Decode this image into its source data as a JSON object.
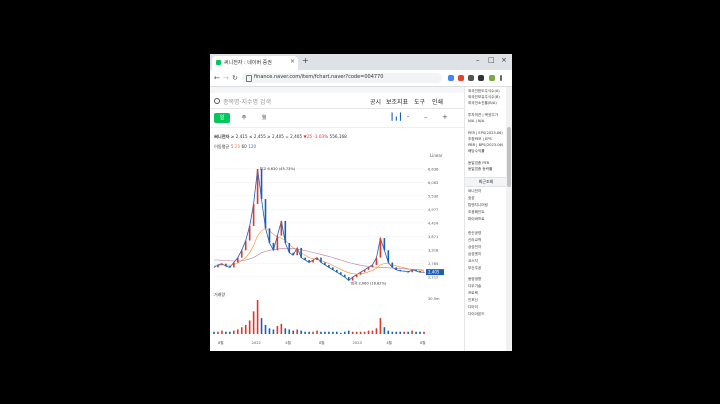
{
  "browser": {
    "tab_title": "써니전자 : 네이버 증권",
    "tab_close": "×",
    "new_tab": "+",
    "url": "finance.naver.com/item/fchart.naver?code=004770",
    "window_controls": {
      "minimize": "–",
      "maximize": "□",
      "close": "×"
    },
    "nav": {
      "back": "←",
      "forward": "→",
      "reload": "↻"
    }
  },
  "search": {
    "placeholder": "종목명·지수명 검색"
  },
  "top_nav": [
    "공시",
    "보조지표",
    "도구",
    "인쇄"
  ],
  "periods": [
    "일",
    "주",
    "월"
  ],
  "active_period": "일",
  "toolbar_icons": [
    "candle-icon",
    "minus-icon",
    "plus-icon"
  ],
  "price_bar": {
    "name": "써니전자",
    "items": [
      "≥ 2,415",
      "≤ 2,455",
      "≥ 2,405",
      "= 2,405",
      "▼25",
      "-1.03%",
      "556,168"
    ]
  },
  "ma_line": {
    "label": "이동평균",
    "values": [
      "5",
      "20",
      "60",
      "120"
    ]
  },
  "chart_data": {
    "type": "line",
    "scale_label": "Linear",
    "y_ticks": [
      "6,636",
      "6,083",
      "5,530",
      "4,977",
      "4,424",
      "3,871",
      "3,318",
      "2,765",
      "2,212"
    ],
    "x_ticks": [
      "8월",
      "2022",
      "4월",
      "8월",
      "2023",
      "4월",
      "8월"
    ],
    "current_price": "2,405",
    "high_annotation": "최고 6,630 (45.73%)",
    "low_annotation": "최저 2,060 (16.82%)",
    "volume_label": "거래량",
    "volume_tick": "30.5m",
    "ylim": [
      2000,
      7000
    ],
    "series": [
      {
        "name": "price",
        "color": "#1a5fb4",
        "values": [
          2600,
          2700,
          2750,
          2650,
          2600,
          2800,
          3000,
          3300,
          3700,
          4300,
          5200,
          6630,
          5400,
          4200,
          3600,
          3300,
          3900,
          4500,
          3600,
          3200,
          3100,
          3400,
          3000,
          2900,
          2800,
          2900,
          3000,
          2800,
          2700,
          2600,
          2500,
          2400,
          2300,
          2200,
          2060,
          2200,
          2300,
          2400,
          2500,
          2600,
          2700,
          3000,
          3800,
          3300,
          2800,
          2600,
          2500,
          2450,
          2450,
          2400,
          2500,
          2450,
          2400,
          2405
        ]
      },
      {
        "name": "ma20",
        "color": "#f28e2b",
        "values": [
          2650,
          2680,
          2700,
          2700,
          2690,
          2720,
          2780,
          2880,
          3000,
          3200,
          3500,
          3900,
          4100,
          4200,
          4100,
          3950,
          3850,
          3800,
          3700,
          3550,
          3400,
          3300,
          3200,
          3100,
          3000,
          2950,
          2920,
          2880,
          2820,
          2760,
          2680,
          2600,
          2520,
          2440,
          2380,
          2340,
          2320,
          2330,
          2360,
          2420,
          2480,
          2560,
          2700,
          2760,
          2740,
          2700,
          2660,
          2620,
          2580,
          2540,
          2520,
          2500,
          2470,
          2450
        ]
      },
      {
        "name": "ma120",
        "color": "#b07aa1",
        "values": [
          2900,
          2900,
          2890,
          2880,
          2870,
          2860,
          2860,
          2870,
          2900,
          2950,
          3000,
          3100,
          3200,
          3250,
          3300,
          3330,
          3350,
          3370,
          3380,
          3380,
          3370,
          3350,
          3320,
          3290,
          3250,
          3210,
          3170,
          3130,
          3090,
          3050,
          3000,
          2950,
          2900,
          2850,
          2800,
          2760,
          2720,
          2690,
          2660,
          2640,
          2620,
          2610,
          2600,
          2590,
          2580,
          2570,
          2560,
          2550,
          2540,
          2530,
          2520,
          2510,
          2500,
          2490
        ]
      }
    ],
    "volume": [
      2,
      2,
      3,
      2,
      2,
      3,
      4,
      6,
      8,
      12,
      20,
      30,
      14,
      8,
      5,
      4,
      7,
      9,
      5,
      4,
      3,
      4,
      3,
      2,
      2,
      2,
      3,
      2,
      2,
      2,
      2,
      2,
      1,
      2,
      3,
      2,
      2,
      2,
      2,
      3,
      3,
      5,
      14,
      6,
      3,
      2,
      2,
      2,
      2,
      2,
      3,
      2,
      2,
      2
    ]
  },
  "right_panel": {
    "top_lines": [
      "외국인한도주식수(A)",
      "외국인보유주식수(B)",
      "외국인소진율(B/A)",
      "",
      "투자의견 | 목표주가",
      "N/A | N/A",
      "",
      "PER | EPS(2023.06)",
      "추정PER | EPS",
      "PBR | BPS(2023.06)",
      "배당수익률",
      "",
      "동일업종 PER",
      "동일업종 등락률"
    ],
    "recent_header": "최근조회",
    "recent_items": [
      "써니전자",
      "효성",
      "탑엔지니어링",
      "조광페인트",
      "파이버프로",
      "",
      "한신공영",
      "신라교역",
      "삼성전자",
      "삼성엔지",
      "코스닥",
      "부산주공"
    ],
    "recent_items_2": [
      "동양생명",
      "다우기술",
      "프로텍",
      "인포신",
      "디아이",
      "다이아몬드"
    ]
  },
  "colors": {
    "accent": "#03c75a",
    "up": "#e0352a",
    "down": "#1a5fb4",
    "current_tag": "#1a5fb4"
  }
}
